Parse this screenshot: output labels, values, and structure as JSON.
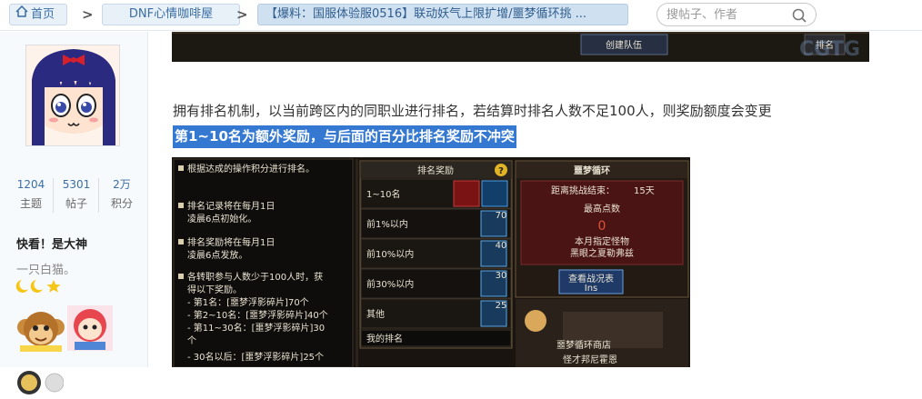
{
  "breadcrumb": {
    "home": "首页",
    "board": "DNF心情咖啡屋",
    "thread": "【爆料：国服体验服0516】联动妖气上限扩增/噩梦循环挑 ..."
  },
  "search": {
    "placeholder": "搜帖子、作者"
  },
  "sidebar": {
    "stats": [
      {
        "value": "1204",
        "label": "主题"
      },
      {
        "value": "5301",
        "label": "帖子"
      },
      {
        "value": "2万",
        "label": "积分"
      }
    ],
    "user_name": "快看！是大神",
    "signature": "一只白猫。"
  },
  "top_image": {
    "create_team": "创建队伍",
    "rank": "排名",
    "watermark": "CGTG"
  },
  "article": {
    "paragraph": "拥有排名机制，以当前跨区内的同职业进行排名，若结算时排名人数不足100人，则奖励额度会变更",
    "highlight": "第1~10名为额外奖励，与后面的百分比排名奖励不冲突"
  },
  "game": {
    "left_panel": [
      "根据达成的操作积分进行排名。",
      "排名记录将在每月1日",
      "凌晨6点初始化。",
      "排名奖励将在每月1日",
      "凌晨6点发放。",
      "各转职参与人数少于100人时，获",
      "得以下奖励。",
      "- 第1名：[噩梦浮影碎片]70个",
      "- 第2~10名：[噩梦浮影碎片]40个",
      "- 第11~30名：[噩梦浮影碎片]30",
      "个",
      "- 30名以后：[噩梦浮影碎片]25个"
    ],
    "rank_title": "排名奖励",
    "help": "?",
    "rank_rows": [
      {
        "label": "1~10名",
        "count": ""
      },
      {
        "label": "前1%以内",
        "count": "70"
      },
      {
        "label": "前10%以内",
        "count": "40"
      },
      {
        "label": "前30%以内",
        "count": "30"
      },
      {
        "label": "其他",
        "count": "25"
      }
    ],
    "my_rank": "我的排名",
    "right_title": "噩梦循环",
    "countdown": "距离挑战结束：",
    "countdown_value": "15天",
    "highest": "最高点数",
    "highest_value": "0",
    "monster_label": "本月指定怪物",
    "monster_name": "黑眼之夏勒弗兹",
    "view_btn": "查看战况表",
    "view_key": "Ins",
    "shop1": "噩梦循环商店",
    "shop2": "怪才邦尼霍恩"
  },
  "colors": {
    "accent": "#3478d2",
    "link": "#3a6ea5",
    "crumb_bg": "#e8f0f8"
  }
}
